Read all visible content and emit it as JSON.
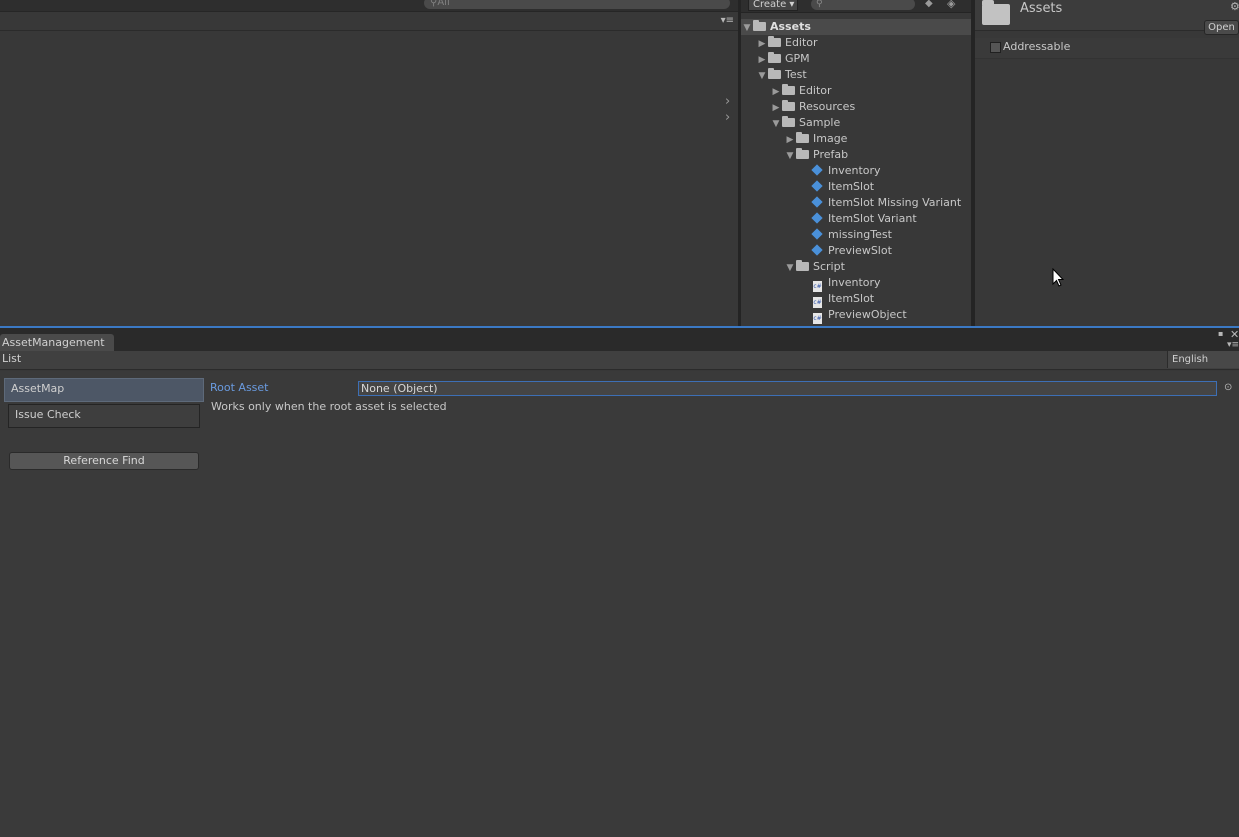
{
  "scene": {
    "search_placeholder": "All",
    "menu_icon": "≡"
  },
  "project": {
    "create_label": "Create",
    "tree": [
      {
        "label": "Assets",
        "arrow": "▼",
        "kind": "folder",
        "bold": true
      },
      {
        "label": "Editor",
        "arrow": "▶",
        "kind": "folder"
      },
      {
        "label": "GPM",
        "arrow": "▶",
        "kind": "folder"
      },
      {
        "label": "Test",
        "arrow": "▼",
        "kind": "folder"
      },
      {
        "label": "Editor",
        "arrow": "▶",
        "kind": "folder"
      },
      {
        "label": "Resources",
        "arrow": "▶",
        "kind": "folder"
      },
      {
        "label": "Sample",
        "arrow": "▼",
        "kind": "folder"
      },
      {
        "label": "Image",
        "arrow": "▶",
        "kind": "folder"
      },
      {
        "label": "Prefab",
        "arrow": "▼",
        "kind": "folder"
      },
      {
        "label": "Inventory",
        "arrow": "",
        "kind": "prefab"
      },
      {
        "label": "ItemSlot",
        "arrow": "",
        "kind": "prefab"
      },
      {
        "label": "ItemSlot Missing Variant",
        "arrow": "",
        "kind": "prefab"
      },
      {
        "label": "ItemSlot Variant",
        "arrow": "",
        "kind": "prefab"
      },
      {
        "label": "missingTest",
        "arrow": "",
        "kind": "prefab"
      },
      {
        "label": "PreviewSlot",
        "arrow": "",
        "kind": "prefab"
      },
      {
        "label": "Script",
        "arrow": "▼",
        "kind": "folder"
      },
      {
        "label": "Inventory",
        "arrow": "",
        "kind": "script"
      },
      {
        "label": "ItemSlot",
        "arrow": "",
        "kind": "script"
      },
      {
        "label": "PreviewObject",
        "arrow": "",
        "kind": "script"
      }
    ]
  },
  "inspector": {
    "title": "Assets",
    "open_label": "Open",
    "addressable_label": "Addressable"
  },
  "asset_management": {
    "tab_label": "AssetManagement",
    "list_label": "List",
    "language": "English",
    "menu_items": [
      "AssetMap",
      "Issue Check"
    ],
    "reference_find_label": "Reference Find",
    "root_asset_label": "Root Asset",
    "root_asset_value": "None (Object)",
    "help_text": "Works only when the root asset is selected"
  }
}
